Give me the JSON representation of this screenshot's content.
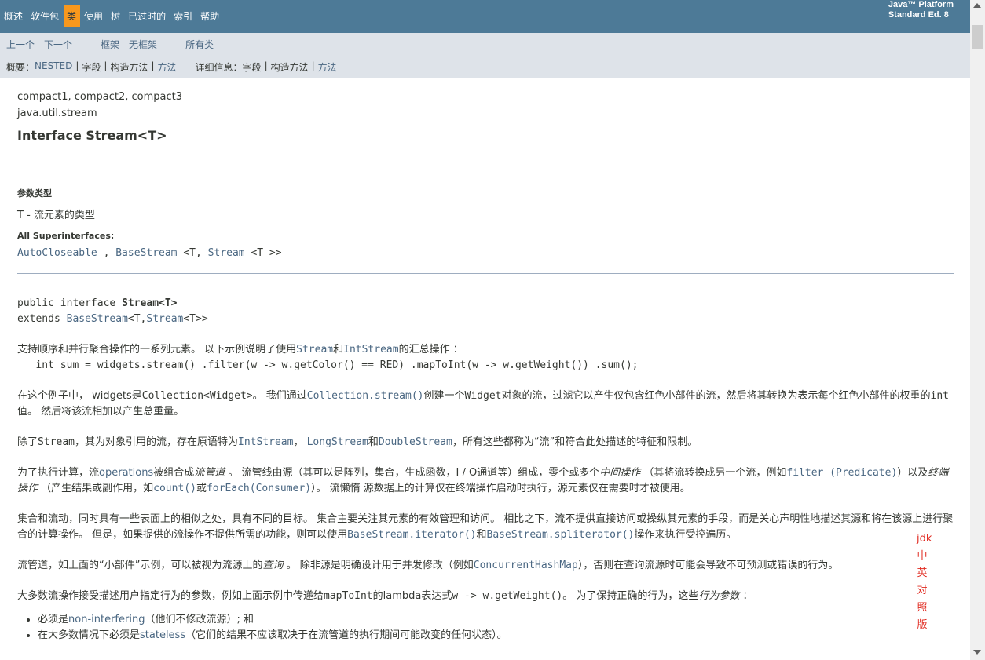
{
  "topnav": {
    "items": [
      {
        "label": "概述"
      },
      {
        "label": "软件包"
      },
      {
        "label": "类"
      },
      {
        "label": "使用"
      },
      {
        "label": "树"
      },
      {
        "label": "已过时的"
      },
      {
        "label": "索引"
      },
      {
        "label": "帮助"
      }
    ],
    "about_line1": "Java™ Platform",
    "about_line2": "Standard Ed. 8"
  },
  "subnav": {
    "prev": "上一个",
    "next": "下一个",
    "frames": "框架",
    "no_frames": "无框架",
    "all_classes": "所有类",
    "summary_label": "概要：",
    "summary_nested": "NESTED",
    "summary_field": "字段",
    "summary_constr": "构造方法",
    "summary_method": "方法",
    "detail_label": "详细信息：",
    "detail_field": "字段",
    "detail_constr": "构造方法",
    "detail_method": "方法",
    "sep": "|"
  },
  "header": {
    "profiles": "compact1, compact2, compact3",
    "package": "java.util.stream",
    "title": "Interface Stream<T>"
  },
  "type_params": {
    "label": "参数类型",
    "value": "T - 流元素的类型"
  },
  "superinterfaces": {
    "label": "All Superinterfaces:",
    "items": [
      "AutoCloseable",
      "BaseStream",
      "Stream"
    ],
    "sep1": " , ",
    "generic1": " <T, ",
    "generic2": " <T >>"
  },
  "declaration": {
    "line1_prefix": "public interface ",
    "line1_name": "Stream<T>",
    "line2_prefix": "extends ",
    "line2_link": "BaseStream",
    "line2_mid": "<T,",
    "line2_link2": "Stream",
    "line2_suffix": "<T>>"
  },
  "paragraphs": {
    "p1_a": "支持顺序和并行聚合操作的一系列元素。 以下示例说明了使用",
    "p1_link1": "Stream",
    "p1_b": "和",
    "p1_link2": "IntStream",
    "p1_c": "的汇总操作 ：",
    "p1_code": "   int sum = widgets.stream() .filter(w -> w.getColor() == RED) .mapToInt(w -> w.getWeight()) .sum();",
    "p2_a": "在这个例子中， widgets是",
    "p2_code1": "Collection<Widget>",
    "p2_b": "。 我们通过",
    "p2_link": "Collection.stream()",
    "p2_c": "创建一个",
    "p2_code2": "Widget",
    "p2_d": "对象的流，过滤它以产生仅包含红色小部件的流，然后将其转换为表示每个红色小部件的权重的",
    "p2_code3": "int",
    "p2_e": "值。 然后将该流相加以产生总重量。",
    "p3_a": "除了",
    "p3_code1": "Stream",
    "p3_b": "，其为对象引用的流，存在原语特为",
    "p3_link1": "IntStream",
    "p3_c": "， ",
    "p3_link2": "LongStream",
    "p3_d": "和",
    "p3_link3": "DoubleStream",
    "p3_e": "，所有这些都称为“流”和符合此处描述的特征和限制。",
    "p4_a": "为了执行计算，流",
    "p4_link1": "operations",
    "p4_b": "被组合成",
    "p4_em1": "流管道",
    "p4_c": " 。 流管线由源（其可以是阵列，集合，生成函数，I / O通道等）组成，零个或多个",
    "p4_em2": "中间操作",
    "p4_d": " （其将流转换成另一个流，例如",
    "p4_link2": "filter (Predicate)",
    "p4_e": "）以及",
    "p4_em3": "终端操作",
    "p4_f": " （产生结果或副作用，如",
    "p4_link3": "count()",
    "p4_g": "或",
    "p4_link4": "forEach(Consumer)",
    "p4_h": "）。 流懒惰 源数据上的计算仅在终端操作启动时执行，源元素仅在需要时才被使用。",
    "p5_a": "集合和流动，同时具有一些表面上的相似之处，具有不同的目标。 集合主要关注其元素的有效管理和访问。 相比之下，流不提供直接访问或操纵其元素的手段，而是关心声明性地描述其源和将在该源上进行聚合的计算操作。 但是，如果提供的流操作不提供所需的功能，则可以使用",
    "p5_link1": "BaseStream.iterator()",
    "p5_b": "和",
    "p5_link2": "BaseStream.spliterator()",
    "p5_c": "操作来执行受控遍历。",
    "p6_a": "流管道，如上面的“小部件”示例，可以被视为流源上的",
    "p6_em": "查询",
    "p6_b": " 。 除非源是明确设计用于并发修改（例如",
    "p6_link": "ConcurrentHashMap",
    "p6_c": "），否则在查询流源时可能会导致不可预测或错误的行为。",
    "p7_a": "大多数流操作接受描述用户指定行为的参数，例如上面示例中传递给",
    "p7_code1": "mapToInt",
    "p7_b": "的lambda表达式",
    "p7_code2": "w -> w.getWeight()",
    "p7_c": "。 为了保持正确的行为，这些",
    "p7_em": "行为参数",
    "p7_d": " ：",
    "li1_a": "必须是",
    "li1_link": "non-interfering",
    "li1_b": "（他们不修改流源）; 和",
    "li2_a": "在大多数情况下必须是",
    "li2_link": "stateless",
    "li2_b": "（它们的结果不应该取决于在流管道的执行期间可能改变的任何状态）。"
  },
  "watermark": [
    "jdk",
    "中",
    "英",
    "对",
    "照",
    "版"
  ],
  "colors": {
    "nav_bg": "#4d7a97",
    "active_tab": "#f8981d",
    "subnav_bg": "#dee3e9",
    "link": "#4a6782",
    "watermark": "#e0281e"
  }
}
